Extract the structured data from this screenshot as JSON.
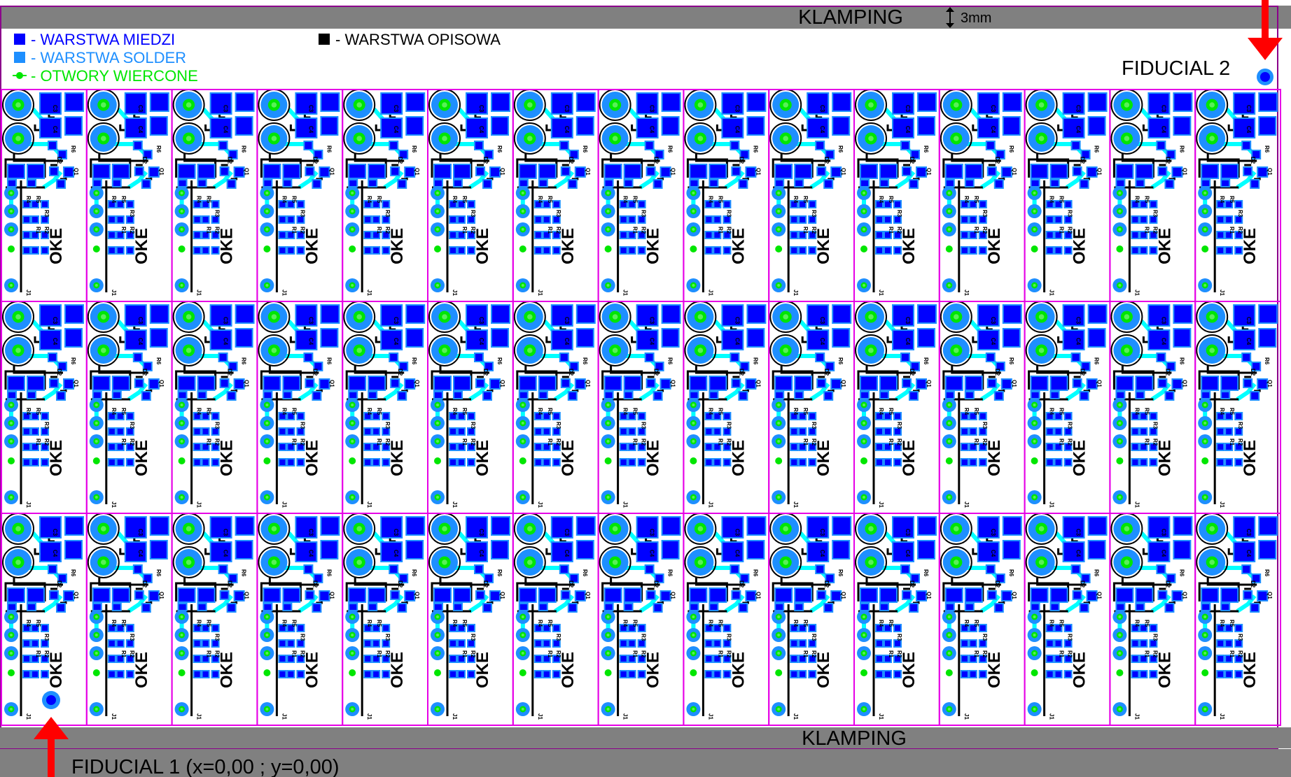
{
  "clamp_label": "KLAMPING",
  "clamp_dimension": "3mm",
  "legend": {
    "copper": {
      "label": "- WARSTWA MIEDZI",
      "color": "#0000ff"
    },
    "solder": {
      "label": "- WARSTWA SOLDER",
      "color": "#1e8fff"
    },
    "drill": {
      "label": "- OTWORY WIERCONE",
      "color": "#00e600"
    },
    "silk": {
      "label": "- WARSTWA OPISOWA",
      "color": "#000000"
    }
  },
  "fiducial_1_label": "FIDUCIAL 1 (x=0,00 ; y=0,00)",
  "fiducial_2_label": "FIDUCIAL 2",
  "panel": {
    "columns": 15,
    "rows": 3
  },
  "board": {
    "logo": "OKE",
    "refs": {
      "c3": "C3",
      "c4": "C4",
      "r6": "R6",
      "d2": "D2",
      "q1": "Q1",
      "r4": "R4",
      "r5": "R5",
      "r3": "R3",
      "r1": "R1",
      "r2": "R2",
      "j1": "J1"
    }
  },
  "colors": {
    "clamp_bar": "#808080",
    "board_outline": "#e600e6",
    "frame": "#8b008b",
    "copper": "#0000ff",
    "solder": "#1e8fff",
    "drill": "#00e600",
    "trace": "#00ffff",
    "silk": "#000000",
    "arrow": "#ff0000"
  }
}
